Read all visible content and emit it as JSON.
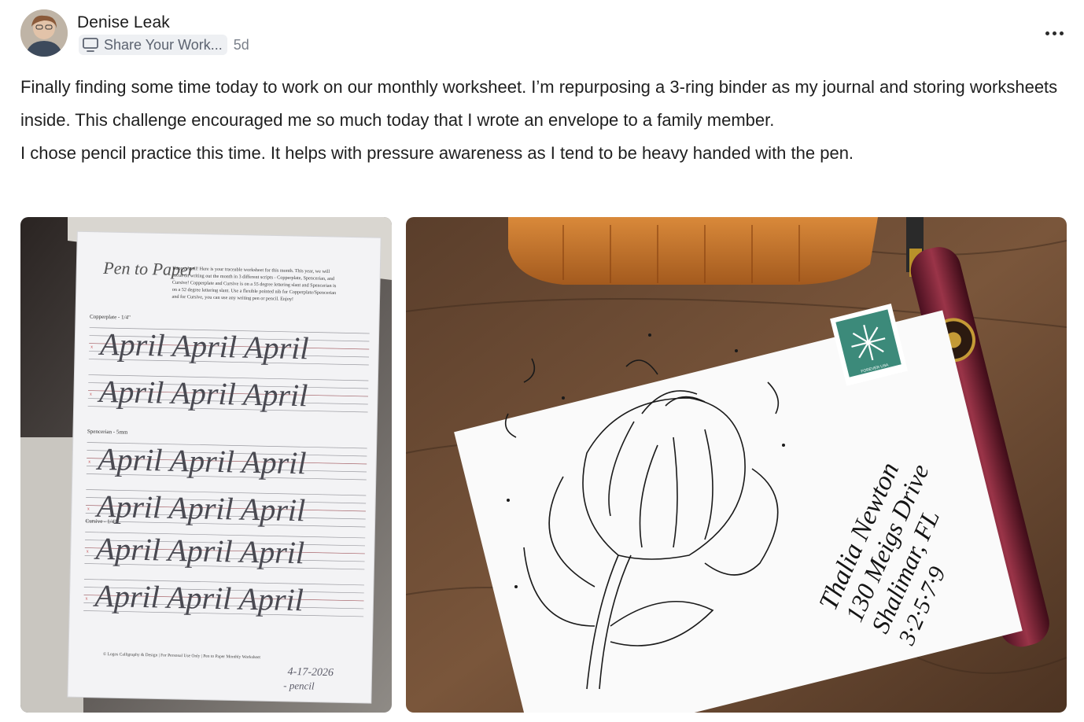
{
  "author": {
    "name": "Denise Leak",
    "avatar_icon": "user-avatar-photo"
  },
  "meta": {
    "space_icon": "monitor-icon",
    "space_label": "Share Your Work...",
    "time": "5d"
  },
  "menu_icon": "more-horizontal-icon",
  "body": {
    "paragraphs": [
      "Finally finding some time today to work on our monthly worksheet. I’m repurposing a 3-ring binder as my journal and storing worksheets inside. This challenge encouraged me so much today that I wrote an envelope to a family member.",
      "I chose pencil practice this time. It helps with pressure awareness as I tend to be heavy handed with the pen."
    ]
  },
  "photos": {
    "worksheet": {
      "intro": [
        "Happy April! Here is your traceable worksheet for this month. This year, we will",
        "focus on writing out the month in 3 different scripts - Copperplate, Spencerian, and",
        "Cursive! Copperplate and Cursive is on a 55 degree lettering slant and Spencerian is",
        "on a 52 degree lettering slant. Use a flexible pointed nib for Copperplate/Spencerian",
        "and for Cursive, you can use any writing pen or pencil. Enjoy!"
      ],
      "sections": [
        {
          "label": "Copperplate - 1/4\"",
          "rows": [
            "April April April",
            "April April April"
          ]
        },
        {
          "label": "Spencerian - 5mm",
          "rows": [
            "April April April",
            "April April April"
          ]
        },
        {
          "label": "Cursive - 1/4\"",
          "rows": [
            "April April April",
            "April April April"
          ]
        }
      ],
      "footer": "© Logos Calligraphy & Design | For Personal Use Only | Pen to Paper Monthly Worksheet",
      "handwritten_date": "4-17-2026",
      "handwritten_note": "- pencil"
    },
    "envelope": {
      "address_lines": [
        "Thalia Newton",
        "130 Meigs Drive",
        "Shalimar, FL",
        "3·2·5·7·9"
      ],
      "stamp_text": "FOREVER USA"
    }
  },
  "colors": {
    "text": "#1f1f1f",
    "muted": "#7a808a",
    "chip_bg": "#eef0f3",
    "table_wood": "#6b4a33",
    "guideline_red": "#c2454a"
  }
}
